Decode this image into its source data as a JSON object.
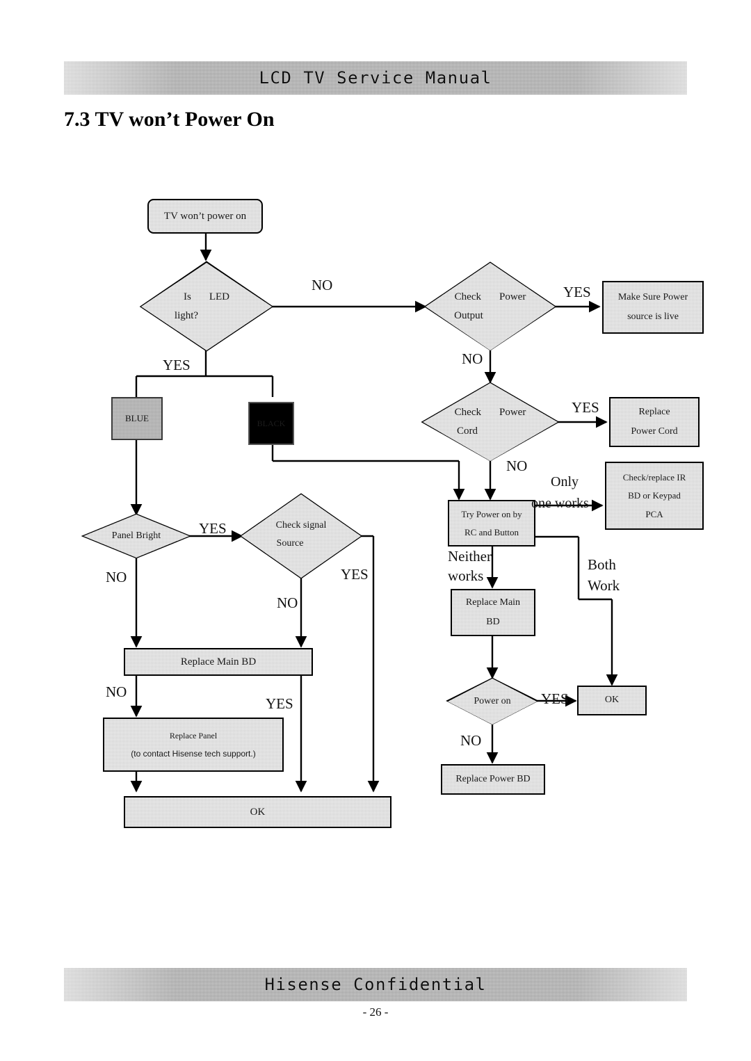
{
  "header": {
    "banner_text": "LCD TV Service Manual"
  },
  "footer": {
    "banner_text": "Hisense Confidential",
    "page_number": "- 26 -"
  },
  "section": {
    "title": "7.3 TV won’t Power On"
  },
  "flowchart": {
    "nodes": {
      "start": {
        "label": "TV won’t power on"
      },
      "is_led_light": {
        "line1": "Is",
        "line2": "LED",
        "line3": "light?"
      },
      "check_power_output": {
        "line1": "Check",
        "line2": "Power",
        "line3": "Output"
      },
      "make_sure_power_live": {
        "line1": "Make Sure Power",
        "line2": "source is live"
      },
      "check_power_cord": {
        "line1": "Check",
        "line2": "Power",
        "line3": "Cord"
      },
      "replace_power_cord": {
        "line1": "Replace",
        "line2": "Power Cord"
      },
      "blue": {
        "label": "BLUE"
      },
      "black": {
        "label": "BLACK"
      },
      "try_power_on": {
        "line1": "Try Power on by",
        "line2": "RC and Button"
      },
      "check_replace_ir": {
        "line1": "Check/replace IR",
        "line2": "BD or Keypad",
        "line3": "PCA"
      },
      "panel_bright": {
        "label": "Panel Bright"
      },
      "check_signal_source": {
        "line1": "Check signal",
        "line2": "Source"
      },
      "replace_main_bd_left": {
        "label": "Replace Main BD"
      },
      "replace_panel": {
        "line1": "Replace Panel",
        "line2": "(to contact Hisense tech support.)"
      },
      "ok_left": {
        "label": "OK"
      },
      "replace_main_bd_right": {
        "line1": "Replace Main",
        "line2": "BD"
      },
      "power_on": {
        "label": "Power on"
      },
      "ok_right": {
        "label": "OK"
      },
      "replace_power_bd": {
        "label": "Replace Power BD"
      }
    },
    "edge_labels": {
      "led_no": "NO",
      "led_yes": "YES",
      "output_yes": "YES",
      "output_no": "NO",
      "cord_yes": "YES",
      "cord_no": "NO",
      "only_one_works_1": "Only",
      "only_one_works_2": "one works",
      "neither_1": "Neither",
      "neither_2": "works",
      "both_1": "Both",
      "both_2": "Work",
      "panel_yes": "YES",
      "panel_no": "NO",
      "signal_yes": "YES",
      "signal_no": "NO",
      "main_bd_no": "NO",
      "main_bd_yes": "YES",
      "power_on_yes": "YES",
      "power_on_no": "NO"
    }
  },
  "colors": {
    "node_fill": "#c9c9c9",
    "stroke": "#000000",
    "black_fill": "#000000",
    "blue_fill": "#9e9e9e"
  }
}
